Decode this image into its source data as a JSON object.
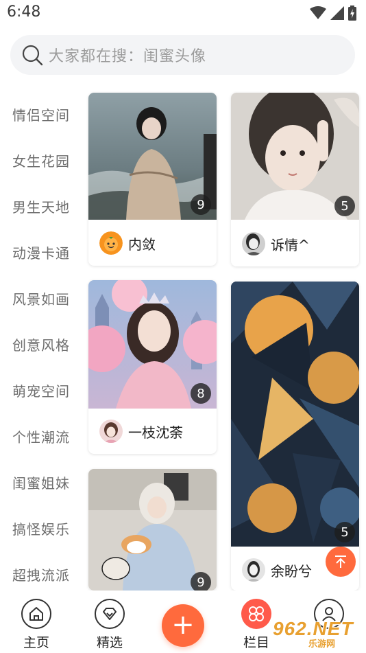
{
  "status": {
    "time": "6:48"
  },
  "search": {
    "placeholder": "大家都在搜：闺蜜头像"
  },
  "sidebar": {
    "items": [
      {
        "label": "情侣空间"
      },
      {
        "label": "女生花园"
      },
      {
        "label": "男生天地"
      },
      {
        "label": "动漫卡通"
      },
      {
        "label": "风景如画"
      },
      {
        "label": "创意风格"
      },
      {
        "label": "萌宠空间"
      },
      {
        "label": "个性潮流"
      },
      {
        "label": "闺蜜姐妹"
      },
      {
        "label": "搞怪娱乐"
      },
      {
        "label": "超拽流派"
      }
    ]
  },
  "cards": [
    {
      "name": "内敛",
      "count": "9"
    },
    {
      "name": "诉情^",
      "count": "5"
    },
    {
      "name": "一枝沈荼",
      "count": "8"
    },
    {
      "name": "余盼兮",
      "count": "5"
    },
    {
      "name": "",
      "count": "9"
    }
  ],
  "tabbar": {
    "home": "主页",
    "featured": "精选",
    "add": "+",
    "columns": "栏目",
    "mine": ""
  },
  "watermark": {
    "main": "962.NET",
    "sub": "乐游网"
  },
  "colors": {
    "accent": "#ff6a3d",
    "text": "#333333",
    "muted": "#9b9b9b"
  }
}
